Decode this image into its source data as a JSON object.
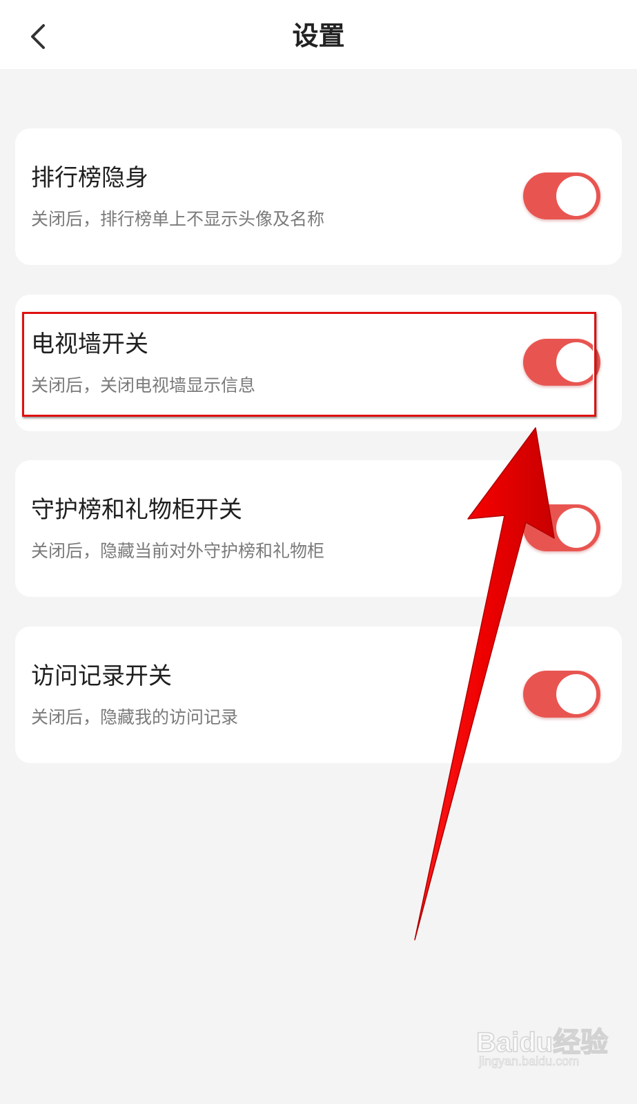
{
  "header": {
    "title": "设置",
    "back_icon": "chevron-left-icon"
  },
  "settings": [
    {
      "title": "排行榜隐身",
      "description": "关闭后，排行榜单上不显示头像及名称",
      "enabled": true
    },
    {
      "title": "电视墙开关",
      "description": "关闭后，关闭电视墙显示信息",
      "enabled": true
    },
    {
      "title": "守护榜和礼物柜开关",
      "description": "关闭后，隐藏当前对外守护榜和礼物柜",
      "enabled": true
    },
    {
      "title": "访问记录开关",
      "description": "关闭后，隐藏我的访问记录",
      "enabled": true
    }
  ],
  "colors": {
    "accent": "#e85551",
    "page_background": "#f4f4f4",
    "card_background": "#ffffff",
    "annotation_red": "#ff0000"
  },
  "annotation": {
    "highlighted_item": "电视墙开关",
    "arrow_icon": "red-arrow-icon"
  },
  "watermark": {
    "logo": "Baidu经验",
    "url": "jingyan.baidu.com"
  }
}
